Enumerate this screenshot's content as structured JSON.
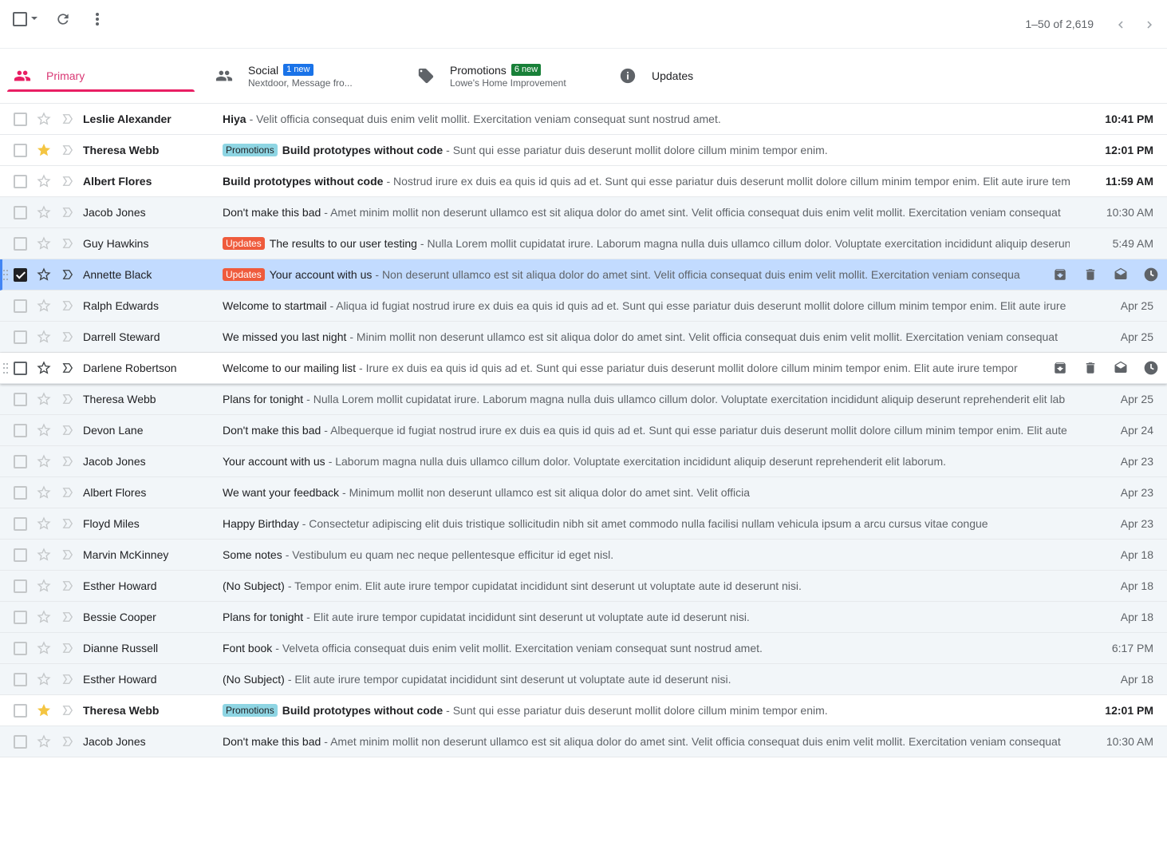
{
  "toolbar": {
    "pagination": "1–50 of 2,619",
    "icons": [
      "checkbox-icon",
      "caret-down-icon",
      "refresh-icon",
      "more-vert-icon",
      "chevron-left-icon",
      "chevron-right-icon"
    ]
  },
  "tabs": [
    {
      "label": "Primary",
      "sub": "",
      "badge": "",
      "icon": "people-icon"
    },
    {
      "label": "Social",
      "sub": "Nextdoor, Message fro...",
      "badge": "1 new",
      "badge_color": "#1a73e8",
      "icon": "people-icon"
    },
    {
      "label": "Promotions",
      "sub": "Lowe's Home Improvement",
      "badge": "6 new",
      "badge_color": "#188038",
      "icon": "tag-icon"
    },
    {
      "label": "Updates",
      "sub": "",
      "badge": "",
      "icon": "info-icon"
    }
  ],
  "colors": {
    "primary_accent": "#e91e63",
    "selected_row": "#c2dbff",
    "promotions_tag": "#8ed5e3",
    "updates_tag": "#ef5b3c"
  },
  "emails": [
    {
      "sender": "Leslie Alexander",
      "tag": "",
      "subject": "Hiya",
      "snippet": "- Velit officia consequat duis enim velit mollit. Exercitation veniam consequat sunt nostrud amet.",
      "date": "10:41 PM",
      "unread": true,
      "starred": false
    },
    {
      "sender": "Theresa Webb",
      "tag": "Promotions",
      "subject": "Build prototypes without code",
      "snippet": "- Sunt qui esse pariatur duis deserunt mollit dolore cillum minim tempor enim.",
      "date": "12:01 PM",
      "unread": true,
      "starred": true
    },
    {
      "sender": "Albert Flores",
      "tag": "",
      "subject": "Build prototypes without code",
      "snippet": "- Nostrud irure ex duis ea quis id quis ad et. Sunt qui esse pariatur duis deserunt mollit dolore cillum minim tempor enim. Elit aute irure tempor",
      "date": "11:59 AM",
      "unread": true,
      "starred": false
    },
    {
      "sender": "Jacob Jones",
      "tag": "",
      "subject": "Don't make this bad",
      "snippet": "- Amet minim mollit non deserunt ullamco est sit aliqua dolor do amet sint. Velit officia consequat duis enim velit mollit. Exercitation veniam consequat",
      "date": "10:30 AM",
      "unread": false,
      "starred": false
    },
    {
      "sender": "Guy Hawkins",
      "tag": "Updates",
      "subject": "The results to our user testing",
      "snippet": "- Nulla Lorem mollit cupidatat irure. Laborum magna nulla duis ullamco cillum dolor. Voluptate exercitation incididunt aliquip deserunt",
      "date": "5:49 AM",
      "unread": false,
      "starred": false
    },
    {
      "sender": "Annette Black",
      "tag": "Updates",
      "subject": "Your account with us",
      "snippet": "- Non deserunt ullamco est sit aliqua dolor do amet sint. Velit officia consequat duis enim velit mollit. Exercitation veniam consequat",
      "date": "",
      "unread": false,
      "starred": false,
      "selected": true
    },
    {
      "sender": "Ralph Edwards",
      "tag": "",
      "subject": "Welcome to startmail",
      "snippet": "- Aliqua id fugiat nostrud irure ex duis ea quis id quis ad et. Sunt qui esse pariatur duis deserunt mollit dolore cillum minim tempor enim. Elit aute irure",
      "date": "Apr 25",
      "unread": false,
      "starred": false
    },
    {
      "sender": "Darrell Steward",
      "tag": "",
      "subject": "We missed you last night",
      "snippet": "- Minim mollit non deserunt ullamco est sit aliqua dolor do amet sint. Velit officia consequat duis enim velit mollit. Exercitation veniam consequat",
      "date": "Apr 25",
      "unread": false,
      "starred": false
    },
    {
      "sender": "Darlene Robertson",
      "tag": "",
      "subject": "Welcome to our mailing list",
      "snippet": "- Irure ex duis ea quis id quis ad et. Sunt qui esse pariatur duis deserunt mollit dolore cillum minim tempor enim. Elit aute irure tempor",
      "date": "",
      "unread": false,
      "starred": false,
      "hover": true
    },
    {
      "sender": "Theresa Webb",
      "tag": "",
      "subject": "Plans for tonight",
      "snippet": "- Nulla Lorem mollit cupidatat irure. Laborum magna nulla duis ullamco cillum dolor. Voluptate exercitation incididunt aliquip deserunt reprehenderit elit lab",
      "date": "Apr 25",
      "unread": false,
      "starred": false
    },
    {
      "sender": "Devon Lane",
      "tag": "",
      "subject": "Don't make this bad",
      "snippet": "- Albequerque id fugiat nostrud irure ex duis ea quis id quis ad et. Sunt qui esse pariatur duis deserunt mollit dolore cillum minim tempor enim. Elit aute",
      "date": "Apr 24",
      "unread": false,
      "starred": false
    },
    {
      "sender": "Jacob Jones",
      "tag": "",
      "subject": "Your account with us",
      "snippet": "- Laborum magna nulla duis ullamco cillum dolor. Voluptate exercitation incididunt aliquip deserunt reprehenderit elit laborum.",
      "date": "Apr 23",
      "unread": false,
      "starred": false
    },
    {
      "sender": "Albert Flores",
      "tag": "",
      "subject": "We want your feedback",
      "snippet": "- Minimum mollit non deserunt ullamco est sit aliqua dolor do amet sint. Velit officia",
      "date": "Apr 23",
      "unread": false,
      "starred": false
    },
    {
      "sender": "Floyd Miles",
      "tag": "",
      "subject": "Happy Birthday",
      "snippet": "- Consectetur adipiscing elit duis tristique sollicitudin nibh sit amet commodo nulla facilisi nullam vehicula ipsum a arcu cursus vitae congue",
      "date": "Apr 23",
      "unread": false,
      "starred": false
    },
    {
      "sender": "Marvin McKinney",
      "tag": "",
      "subject": "Some notes",
      "snippet": "- Vestibulum eu quam nec neque pellentesque efficitur id eget nisl.",
      "date": "Apr 18",
      "unread": false,
      "starred": false
    },
    {
      "sender": "Esther Howard",
      "tag": "",
      "subject": "(No Subject)",
      "snippet": "- Tempor enim. Elit aute irure tempor cupidatat incididunt sint deserunt ut voluptate aute id deserunt nisi.",
      "date": "Apr 18",
      "unread": false,
      "starred": false
    },
    {
      "sender": "Bessie Cooper",
      "tag": "",
      "subject": "Plans for tonight",
      "snippet": "- Elit aute irure tempor cupidatat incididunt sint deserunt ut voluptate aute id deserunt nisi.",
      "date": "Apr 18",
      "unread": false,
      "starred": false
    },
    {
      "sender": "Dianne Russell",
      "tag": "",
      "subject": "Font book",
      "snippet": "- Velveta officia consequat duis enim velit mollit. Exercitation veniam consequat sunt nostrud amet.",
      "date": "6:17 PM",
      "unread": false,
      "starred": false
    },
    {
      "sender": "Esther Howard",
      "tag": "",
      "subject": "(No Subject)",
      "snippet": "- Elit aute irure tempor cupidatat incididunt sint deserunt ut voluptate aute id deserunt nisi.",
      "date": "Apr 18",
      "unread": false,
      "starred": false
    },
    {
      "sender": "Theresa Webb",
      "tag": "Promotions",
      "subject": "Build prototypes without code",
      "snippet": "- Sunt qui esse pariatur duis deserunt mollit dolore cillum minim tempor enim.",
      "date": "12:01 PM",
      "unread": true,
      "starred": true
    },
    {
      "sender": "Jacob Jones",
      "tag": "",
      "subject": "Don't make this bad",
      "snippet": "- Amet minim mollit non deserunt ullamco est sit aliqua dolor do amet sint. Velit officia consequat duis enim velit mollit. Exercitation veniam consequat",
      "date": "10:30 AM",
      "unread": false,
      "starred": false
    }
  ],
  "row_actions": [
    "archive-icon",
    "delete-icon",
    "mark-read-icon",
    "snooze-icon"
  ]
}
